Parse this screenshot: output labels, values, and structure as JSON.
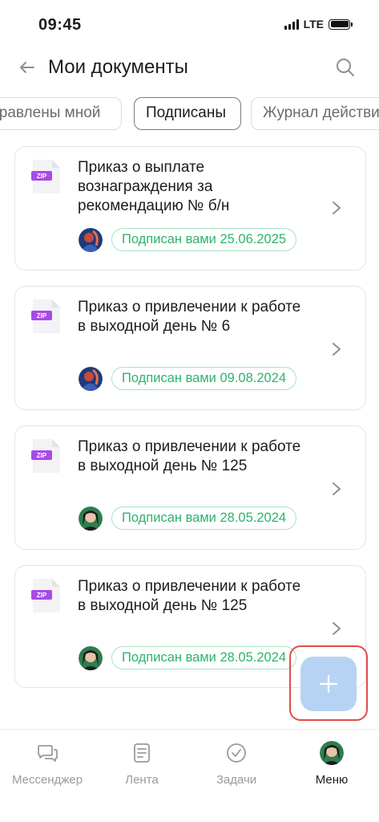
{
  "status_bar": {
    "time": "09:45",
    "network": "LTE"
  },
  "header": {
    "title": "Мои документы"
  },
  "tabs": [
    {
      "label": "Отправлены мной",
      "active": false
    },
    {
      "label": "Подписаны",
      "active": true
    },
    {
      "label": "Журнал действий",
      "active": false
    }
  ],
  "documents": [
    {
      "file_type": "ZIP",
      "title": "Приказ о выплате вознаграждения за рекомендацию № б/н",
      "status": "Подписан вами 25.06.2025",
      "avatar": "user-avatar-1"
    },
    {
      "file_type": "ZIP",
      "title": "Приказ о привлечении к работе в выходной день № 6",
      "status": "Подписан вами 09.08.2024",
      "avatar": "user-avatar-1"
    },
    {
      "file_type": "ZIP",
      "title": "Приказ о привлечении к работе в выходной день № 125",
      "status": "Подписан вами 28.05.2024",
      "avatar": "user-avatar-2"
    },
    {
      "file_type": "ZIP",
      "title": "Приказ о привлечении к работе в выходной день № 125",
      "status": "Подписан вами 28.05.2024",
      "avatar": "user-avatar-2"
    }
  ],
  "fab": {
    "icon": "plus-icon"
  },
  "bottom_nav": [
    {
      "label": "Мессенджер",
      "icon": "chat-icon",
      "active": false
    },
    {
      "label": "Лента",
      "icon": "feed-icon",
      "active": false
    },
    {
      "label": "Задачи",
      "icon": "tasks-icon",
      "active": false
    },
    {
      "label": "Меню",
      "icon": "profile-avatar",
      "active": true
    }
  ],
  "colors": {
    "accent_green": "#2db36b",
    "badge_border": "#a8e3c4",
    "zip_purple": "#a74be6",
    "fab_blue": "#b7d3f3",
    "highlight_red": "#e24b4b"
  }
}
